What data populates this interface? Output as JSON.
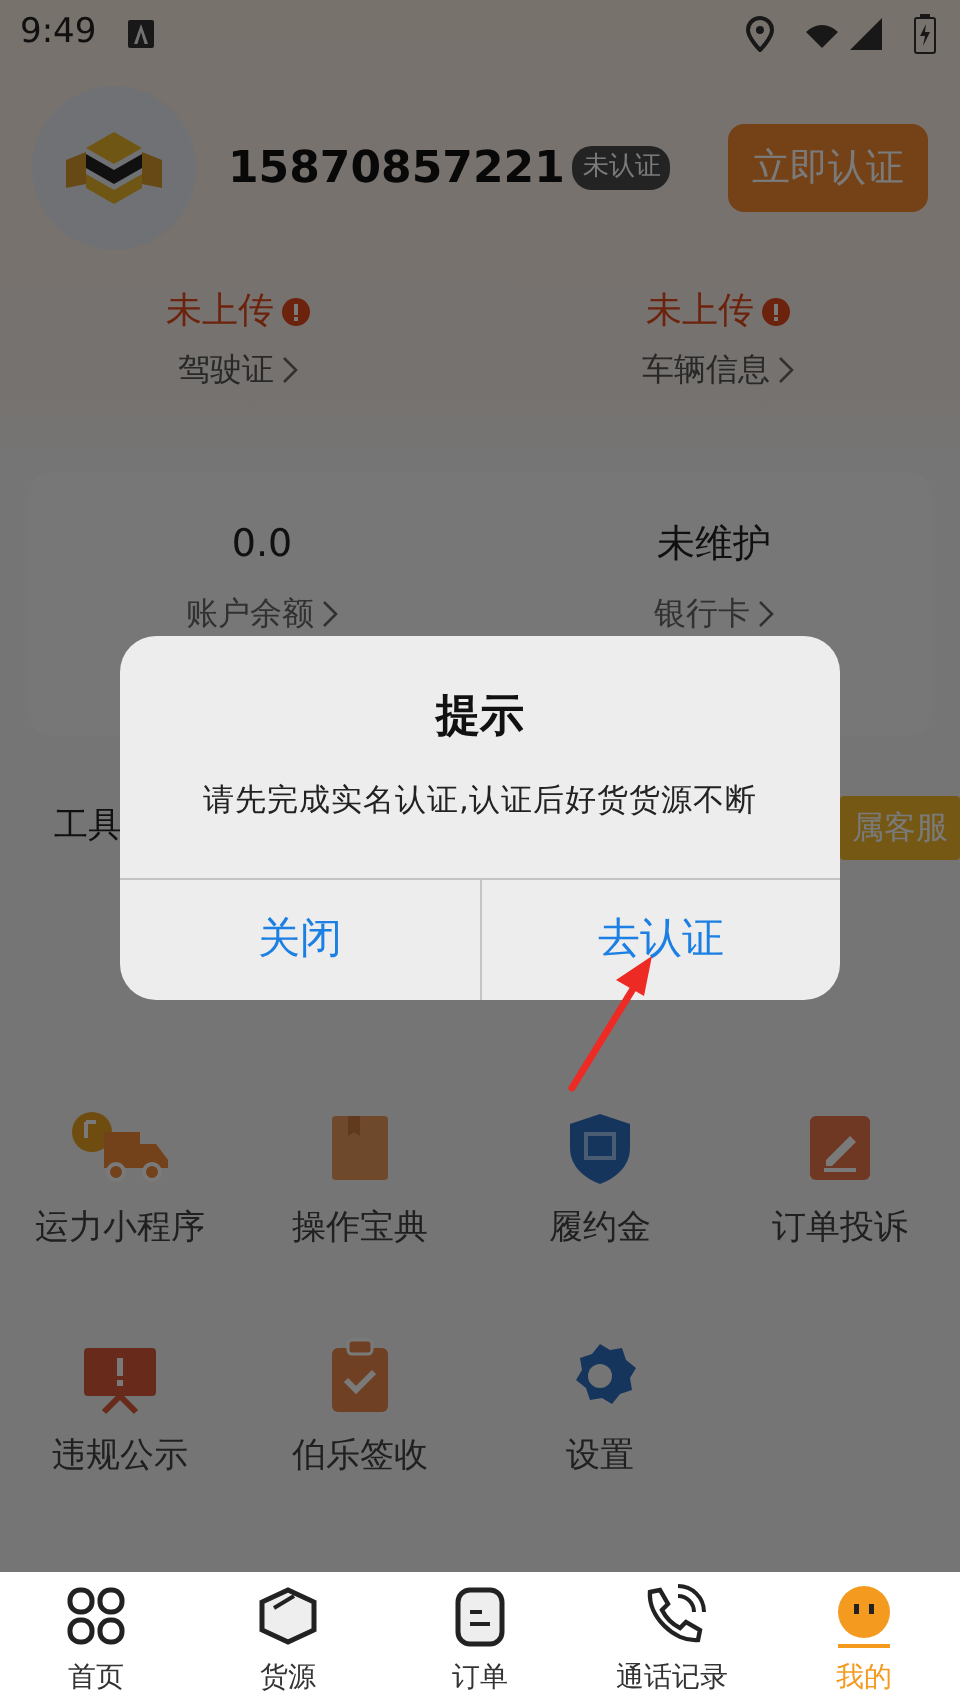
{
  "status_bar": {
    "time": "9:49"
  },
  "profile": {
    "phone": "15870857221",
    "badge": "未认证",
    "verify_button": "立即认证"
  },
  "documents": [
    {
      "status": "未上传",
      "warning": true,
      "label": "驾驶证"
    },
    {
      "status": "未上传",
      "warning": true,
      "label": "车辆信息"
    }
  ],
  "account": [
    {
      "value": "0.0",
      "label": "账户余额"
    },
    {
      "value": "未维护",
      "label": "银行卡"
    }
  ],
  "tools": {
    "title": "工具",
    "service_button": "属客服",
    "items": [
      {
        "label": "运力小程序",
        "kind": "truck"
      },
      {
        "label": "操作宝典",
        "kind": "book"
      },
      {
        "label": "履约金",
        "kind": "shield"
      },
      {
        "label": "订单投诉",
        "kind": "edit"
      },
      {
        "label": "违规公示",
        "kind": "board"
      },
      {
        "label": "伯乐签收",
        "kind": "clipboard"
      },
      {
        "label": "设置",
        "kind": "gear"
      }
    ]
  },
  "tab_bar": [
    {
      "label": "首页",
      "kind": "grid",
      "selected": false
    },
    {
      "label": "货源",
      "kind": "box",
      "selected": false
    },
    {
      "label": "订单",
      "kind": "order",
      "selected": false
    },
    {
      "label": "通话记录",
      "kind": "phone",
      "selected": false
    },
    {
      "label": "我的",
      "kind": "face",
      "selected": true
    }
  ],
  "dialog": {
    "title": "提示",
    "message": "请先完成实名认证,认证后好货货源不断",
    "buttons": [
      "关闭",
      "去认证"
    ]
  }
}
